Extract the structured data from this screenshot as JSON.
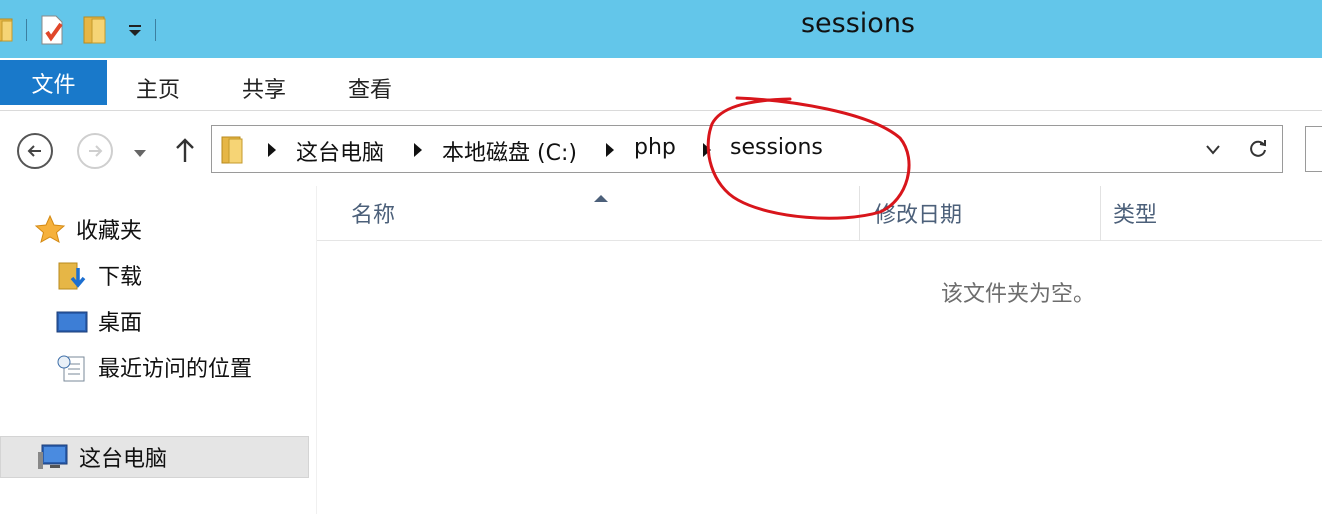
{
  "window": {
    "title": "sessions"
  },
  "quick_access": {
    "icons": [
      "folder-icon",
      "properties-icon",
      "new-folder-icon",
      "customize-dropdown-icon"
    ]
  },
  "ribbon": {
    "file_tab": "文件",
    "tabs": [
      "主页",
      "共享",
      "查看"
    ]
  },
  "navigation": {
    "back_icon": "back-arrow-icon",
    "forward_icon": "forward-arrow-icon",
    "recent_icon": "chevron-down-icon",
    "up_icon": "up-arrow-icon"
  },
  "address_bar": {
    "path": [
      "这台电脑",
      "本地磁盘 (C:)",
      "php",
      "sessions"
    ],
    "dropdown_icon": "chevron-down-icon",
    "refresh_icon": "refresh-icon"
  },
  "sidebar": {
    "items": [
      {
        "label": "收藏夹",
        "icon": "star-icon"
      },
      {
        "label": "下载",
        "icon": "download-folder-icon"
      },
      {
        "label": "桌面",
        "icon": "desktop-icon"
      },
      {
        "label": "最近访问的位置",
        "icon": "recent-places-icon"
      },
      {
        "label": "这台电脑",
        "icon": "computer-icon",
        "selected": true
      }
    ]
  },
  "file_list": {
    "columns": [
      "名称",
      "修改日期",
      "类型"
    ],
    "sort_column": "名称",
    "empty_message": "该文件夹为空。"
  },
  "colors": {
    "titlebar": "#63c6ea",
    "file_tab": "#1979ca",
    "annotation": "#d8151b"
  }
}
